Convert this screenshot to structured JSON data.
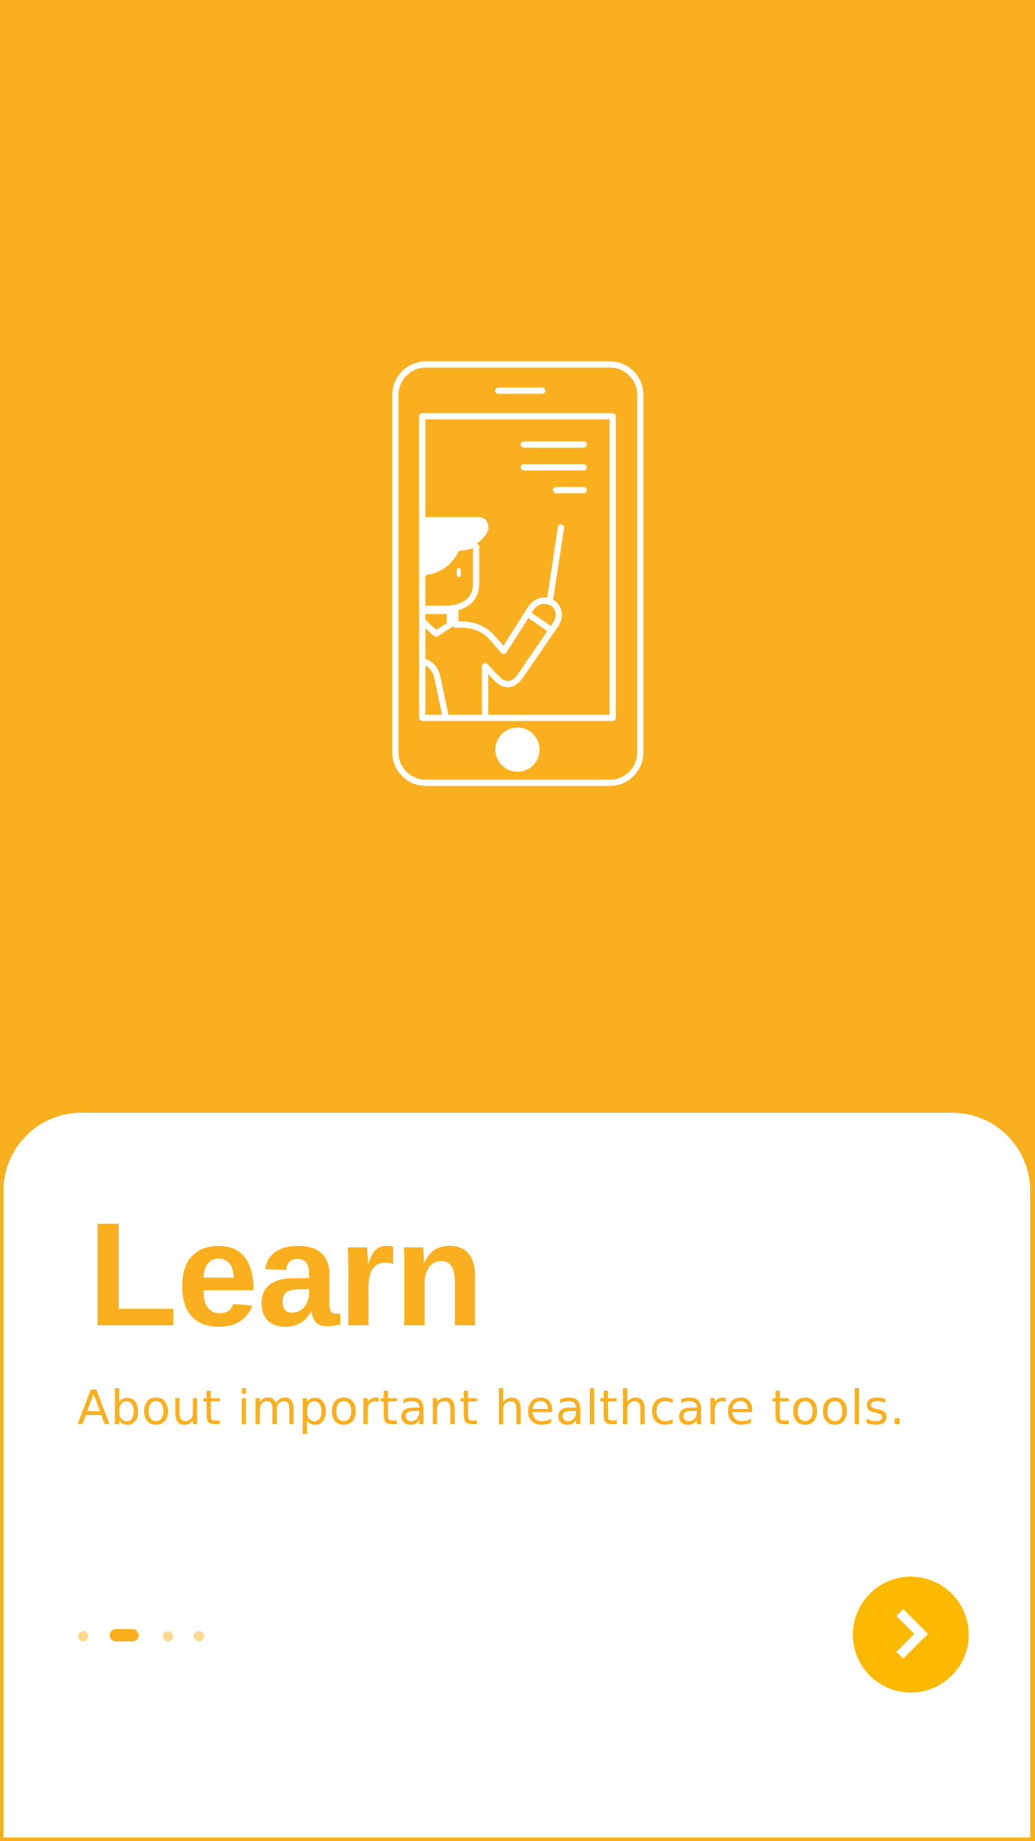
{
  "onboarding": {
    "title": "Learn",
    "subtitle": "About important healthcare tools.",
    "illustration_icon": "phone-tutorial-icon",
    "pager": {
      "total": 4,
      "active_index": 1
    },
    "next_button_icon": "chevron-right-icon"
  },
  "colors": {
    "accent": "#FAAF1E",
    "button": "#FDB900",
    "dot_inactive": "#FFD88F",
    "card": "#FFFFFF",
    "illustration": "#FFFFFF"
  }
}
